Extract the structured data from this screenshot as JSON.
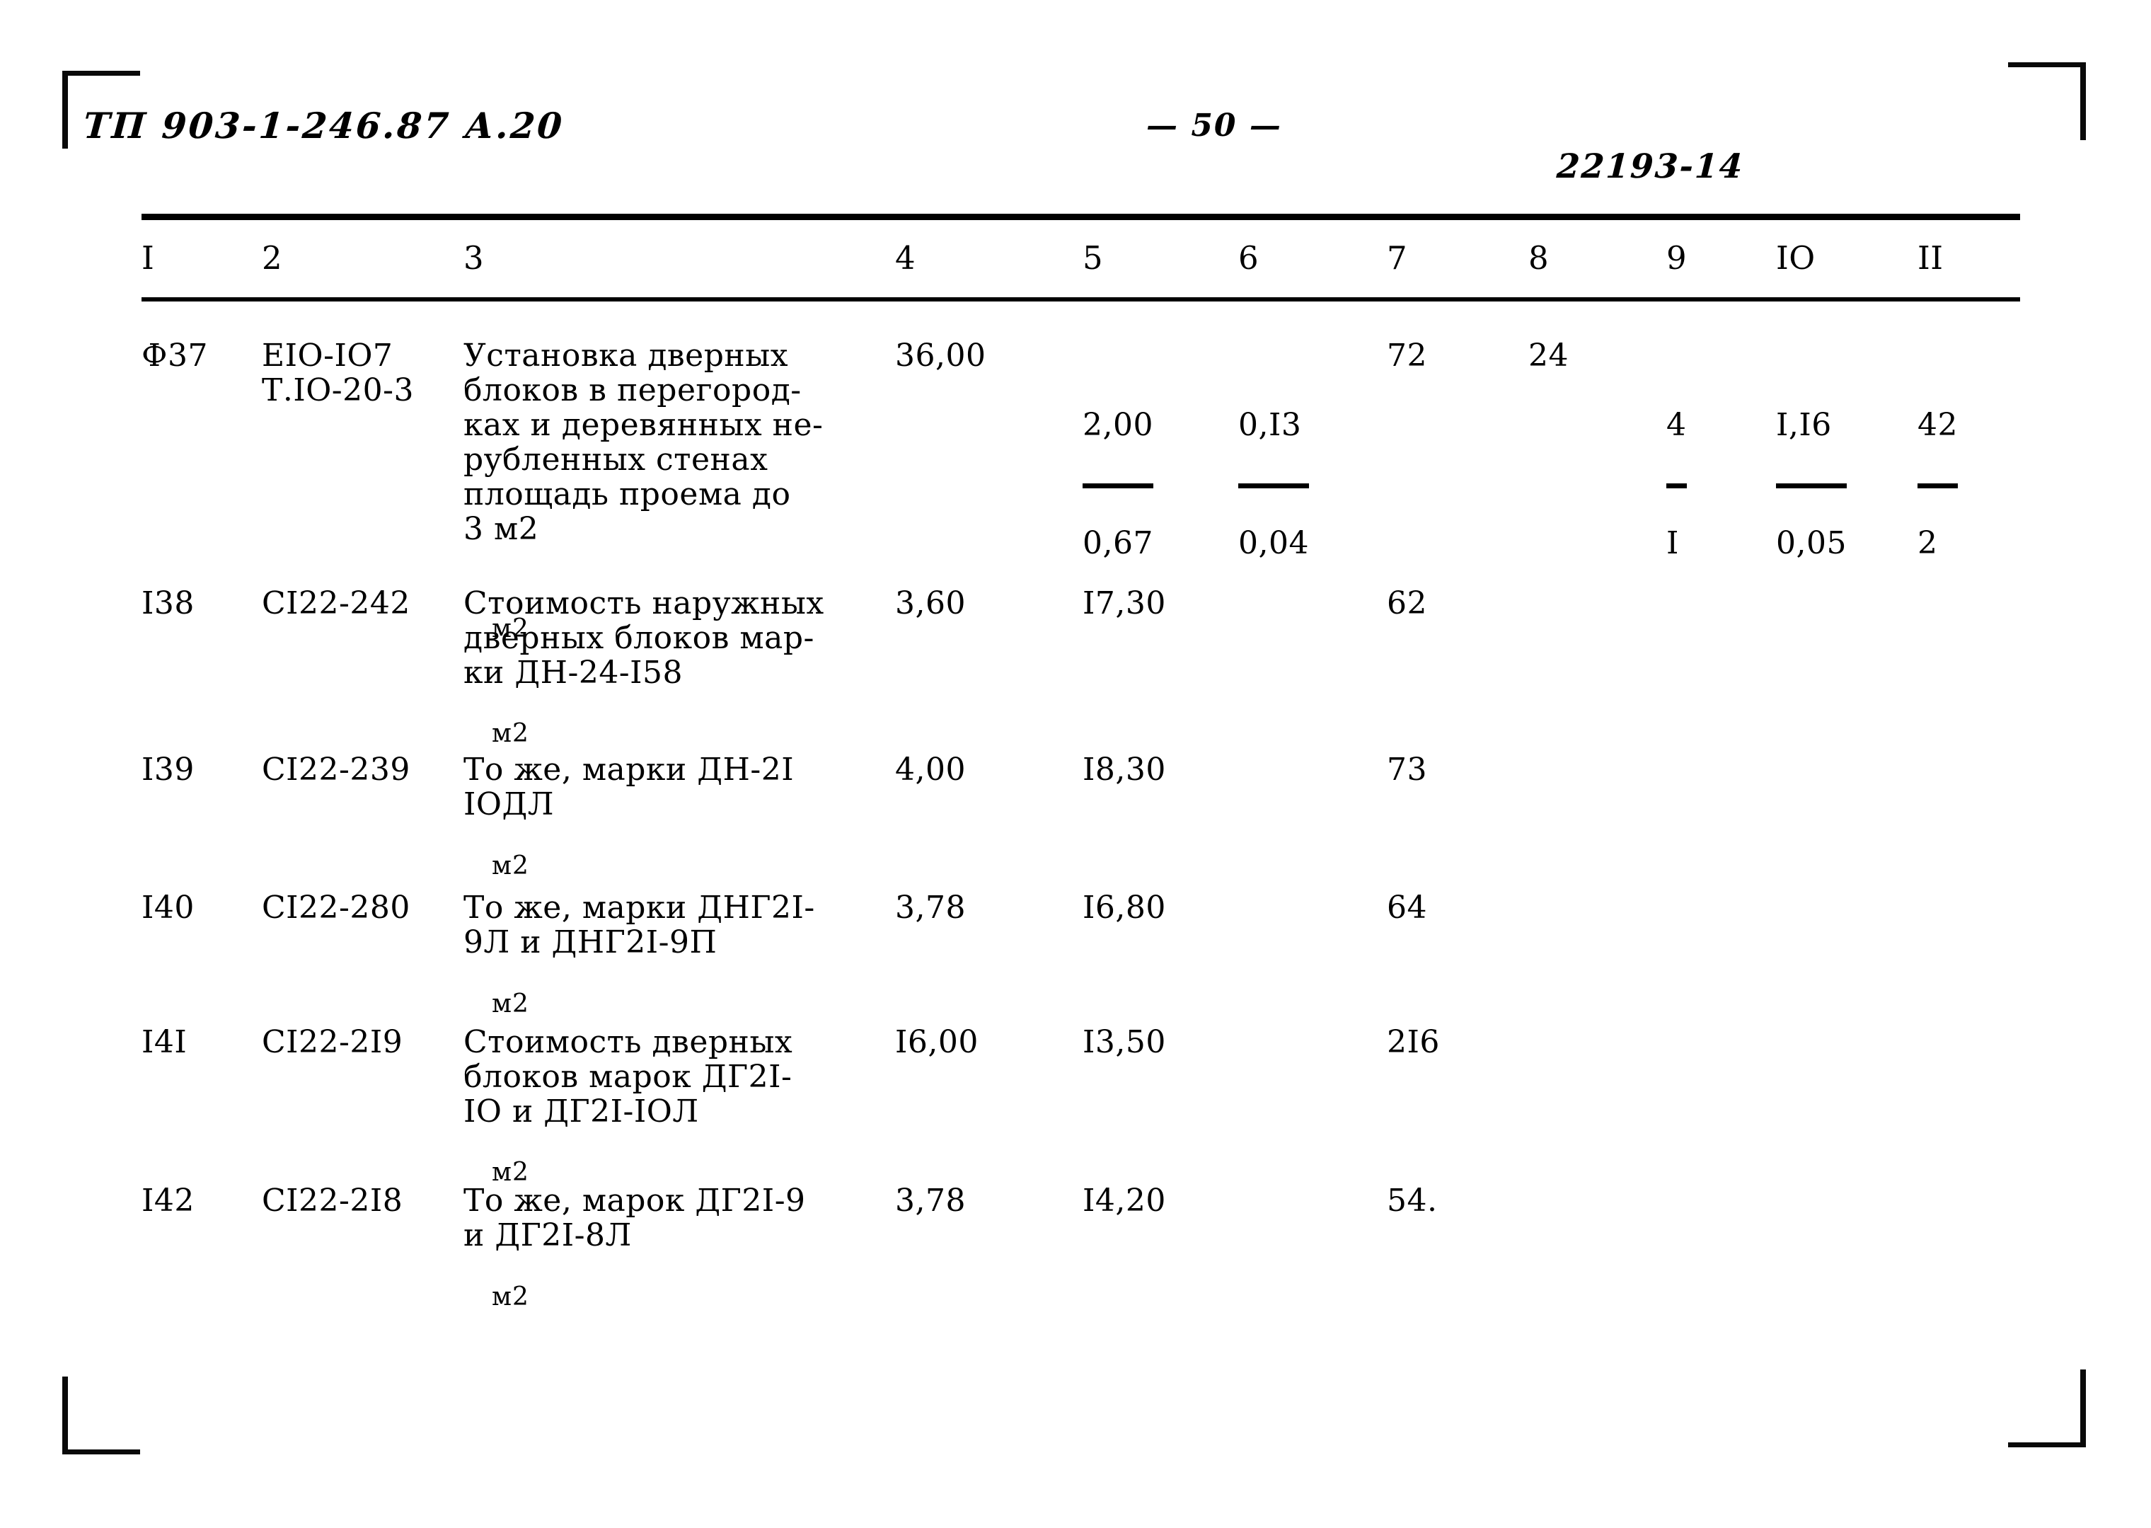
{
  "document": {
    "code": "ТП 903-1-246.87  А.20",
    "page_number": "— 50 —",
    "sheet_code": "22193-14"
  },
  "table": {
    "column_headers": [
      "I",
      "2",
      "3",
      "4",
      "5",
      "6",
      "7",
      "8",
      "9",
      "IO",
      "II"
    ],
    "rows": [
      {
        "c1": "Ф37",
        "c2": "ЕIО-IО7\nТ.IО-20-3",
        "c3": "Установка дверных\nблоков в перегород-\nках и деревянных не-\nрубленных стенах\nплощадь проема до\n3 м2",
        "c3_unit": "м2",
        "c4": "36,00",
        "c5_num": "2,00",
        "c5_den": "0,67",
        "c6_num": "0,I3",
        "c6_den": "0,04",
        "c7": "72",
        "c8": "24",
        "c9_num": "4",
        "c9_den": "I",
        "c10_num": "I,I6",
        "c10_den": "0,05",
        "c11_num": "42",
        "c11_den": "2"
      },
      {
        "c1": "I38",
        "c2": "СI22-242",
        "c3": "Стоимость наружных\nдверных блоков мар-\nки ДН-24-I58",
        "c3_unit": "м2",
        "c4": "3,60",
        "c5": "I7,30",
        "c7": "62"
      },
      {
        "c1": "I39",
        "c2": "СI22-239",
        "c3": "То же, марки ДН-2I\nIОДЛ",
        "c3_unit": "м2",
        "c4": "4,00",
        "c5": "I8,30",
        "c7": "73"
      },
      {
        "c1": "I40",
        "c2": "СI22-280",
        "c3": "То же, марки ДНГ2I-\n9Л и ДНГ2I-9П",
        "c3_unit": "м2",
        "c4": "3,78",
        "c5": "I6,80",
        "c7": "64"
      },
      {
        "c1": "I4I",
        "c2": "СI22-2I9",
        "c3": "Стоимость дверных\nблоков марок ДГ2I-\nIО и ДГ2I-IОЛ",
        "c3_unit": "м2",
        "c4": "I6,00",
        "c5": "I3,50",
        "c7": "2I6"
      },
      {
        "c1": "I42",
        "c2": "СI22-2I8",
        "c3": "То же, марок ДГ2I-9\nи ДГ2I-8Л",
        "c3_unit": "м2",
        "c4": "3,78",
        "c5": "I4,20",
        "c7": "54."
      }
    ]
  }
}
